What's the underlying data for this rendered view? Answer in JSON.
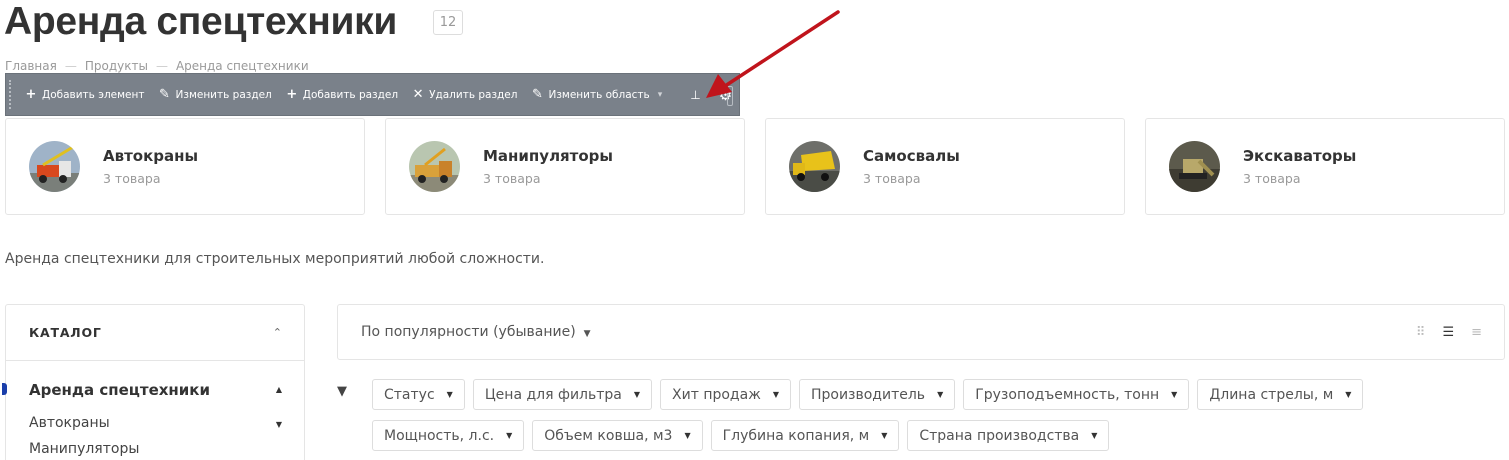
{
  "page": {
    "title": "Аренда спецтехники",
    "count": "12"
  },
  "breadcrumb": {
    "items": [
      "Главная",
      "Продукты",
      "Аренда спецтехники"
    ],
    "separator": "—"
  },
  "admin_toolbar": {
    "add_element": "Добавить элемент",
    "edit_section": "Изменить раздел",
    "add_section": "Добавить раздел",
    "delete_section": "Удалить раздел",
    "edit_area": "Изменить область"
  },
  "categories": [
    {
      "name": "Автокраны",
      "count": "3 товара",
      "icon": "crane-truck"
    },
    {
      "name": "Манипуляторы",
      "count": "3 товара",
      "icon": "manipulator-truck"
    },
    {
      "name": "Самосвалы",
      "count": "3 товара",
      "icon": "dump-truck"
    },
    {
      "name": "Экскаваторы",
      "count": "3 товара",
      "icon": "excavator"
    }
  ],
  "description": "Аренда спецтехники для строительных мероприятий любой сложности.",
  "sidebar": {
    "title": "КАТАЛОГ",
    "active": "Аренда спецтехники",
    "items": [
      "Автокраны",
      "Манипуляторы"
    ]
  },
  "sort": {
    "label": "По популярности (убывание)"
  },
  "filters": [
    "Статус",
    "Цена для фильтра",
    "Хит продаж",
    "Производитель",
    "Грузоподъемность, тонн",
    "Длина стрелы, м",
    "Мощность, л.с.",
    "Объем ковша, м3",
    "Глубина копания, м",
    "Страна производства"
  ],
  "colors": {
    "accent_arrow": "#c0141c",
    "toolbar_bg": "#7a818a",
    "active_mark": "#1a3eaa"
  }
}
